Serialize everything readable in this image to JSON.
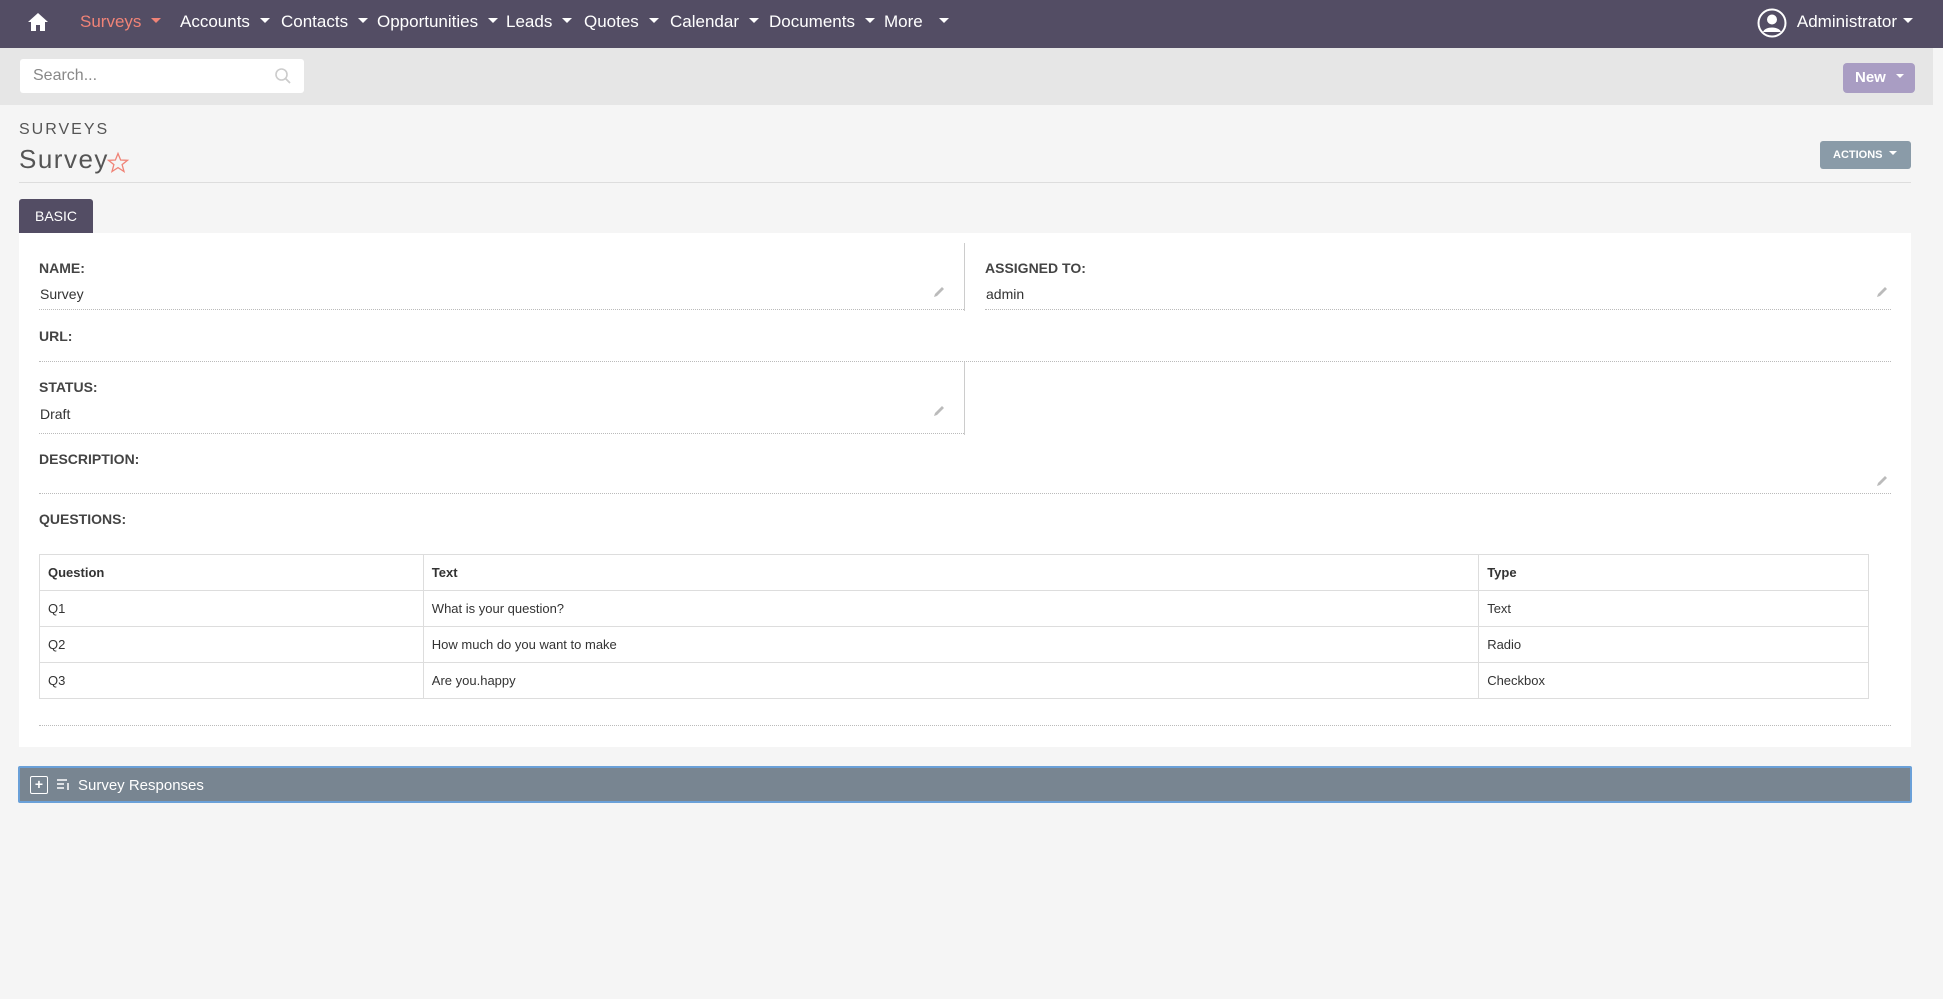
{
  "nav": {
    "items": [
      {
        "label": "Surveys",
        "active": true
      },
      {
        "label": "Accounts"
      },
      {
        "label": "Contacts"
      },
      {
        "label": "Opportunities"
      },
      {
        "label": "Leads"
      },
      {
        "label": "Quotes"
      },
      {
        "label": "Calendar"
      },
      {
        "label": "Documents"
      },
      {
        "label": "More"
      }
    ],
    "user": "Administrator",
    "active_color": "#f08377",
    "bar_color": "#534d64"
  },
  "search": {
    "placeholder": "Search..."
  },
  "toolbar": {
    "new_label": "New",
    "actions_label": "ACTIONS"
  },
  "header": {
    "module": "SURVEYS",
    "title": "Survey"
  },
  "tabs": [
    {
      "label": "BASIC"
    }
  ],
  "fields": {
    "name": {
      "label": "NAME:",
      "value": "Survey"
    },
    "assigned": {
      "label": "ASSIGNED TO:",
      "value": "admin"
    },
    "url": {
      "label": "URL:",
      "value": ""
    },
    "status": {
      "label": "STATUS:",
      "value": "Draft"
    },
    "description": {
      "label": "DESCRIPTION:",
      "value": ""
    },
    "questions": {
      "label": "QUESTIONS:"
    }
  },
  "questions_table": {
    "headers": [
      "Question",
      "Text",
      "Type"
    ],
    "rows": [
      [
        "Q1",
        "What is your question?",
        "Text"
      ],
      [
        "Q2",
        "How much do you want to make",
        "Radio"
      ],
      [
        "Q3",
        "Are you.happy",
        "Checkbox"
      ]
    ]
  },
  "subpanel": {
    "title": "Survey Responses",
    "expand_symbol": "+"
  }
}
